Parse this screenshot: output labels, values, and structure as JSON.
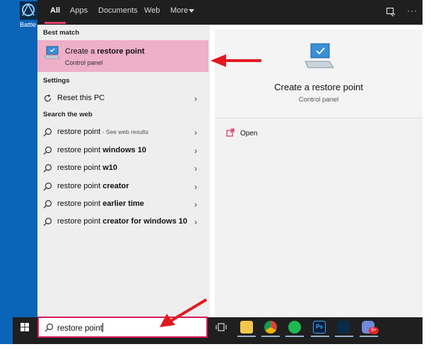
{
  "desktop": {
    "shortcut_label": "Battle"
  },
  "filters": {
    "tabs": [
      "All",
      "Apps",
      "Documents",
      "Web",
      "More"
    ],
    "active": "All",
    "more_menu": "more-options-icon"
  },
  "results": {
    "best_match_header": "Best match",
    "best_match": {
      "title_prefix": "Create a ",
      "title_bold": "restore point",
      "subtitle": "Control panel",
      "icon": "computer-shield-icon"
    },
    "settings_header": "Settings",
    "settings_item": "Reset this PC",
    "web_header": "Search the web",
    "web_items": [
      {
        "plain": "restore point",
        "bold": "",
        "hint": " - See web results"
      },
      {
        "plain": "restore point ",
        "bold": "windows 10",
        "hint": ""
      },
      {
        "plain": "restore point ",
        "bold": "w10",
        "hint": ""
      },
      {
        "plain": "restore point ",
        "bold": "creator",
        "hint": ""
      },
      {
        "plain": "restore point ",
        "bold": "earlier time",
        "hint": ""
      },
      {
        "plain": "restore point ",
        "bold": "creator for windows 10",
        "hint": ""
      }
    ]
  },
  "preview": {
    "title": "Create a restore point",
    "subtitle": "Control panel",
    "open_action": "Open"
  },
  "taskbar": {
    "search_value": "restore point",
    "apps": [
      "task-view-icon",
      "file-explorer-icon",
      "chrome-icon",
      "spotify-icon",
      "photoshop-icon",
      "battlenet-icon",
      "discord-icon"
    ],
    "discord_badge": "9+"
  },
  "colors": {
    "highlight": "#eeafc8",
    "accent": "#e23f6f",
    "arrow": "#e0191f",
    "taskbar": "#1f1f1f"
  }
}
